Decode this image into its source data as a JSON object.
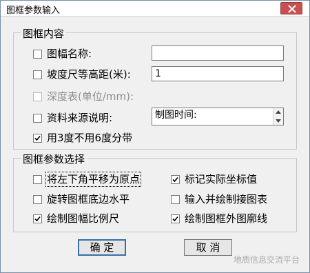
{
  "window": {
    "title": "图框参数输入"
  },
  "groups": {
    "content": {
      "title": "图框内容",
      "rows": [
        {
          "label": "图幅名称:",
          "checked": false,
          "enabled": true,
          "value": ""
        },
        {
          "label": "坡度尺等高距(米):",
          "checked": false,
          "enabled": true,
          "value": "1"
        },
        {
          "label": "深度表(单位/mm):",
          "checked": false,
          "enabled": false,
          "value": ""
        },
        {
          "label": "资料来源说明:",
          "checked": false,
          "enabled": true,
          "value": "制图时间:"
        },
        {
          "label": "用3度不用6度分带",
          "checked": true,
          "enabled": true
        }
      ]
    },
    "options": {
      "title": "图框参数选择",
      "items": [
        {
          "label": "将左下角平移为原点",
          "checked": false
        },
        {
          "label": "标记实际坐标值",
          "checked": true
        },
        {
          "label": "旋转图框底边水平",
          "checked": false
        },
        {
          "label": "输入并绘制接图表",
          "checked": false
        },
        {
          "label": "绘制图幅比例尺",
          "checked": true
        },
        {
          "label": "绘制图框外图廓线",
          "checked": true
        }
      ]
    }
  },
  "buttons": {
    "ok": "确 定",
    "cancel": "取 消"
  },
  "watermark": "地质信息交流平台"
}
